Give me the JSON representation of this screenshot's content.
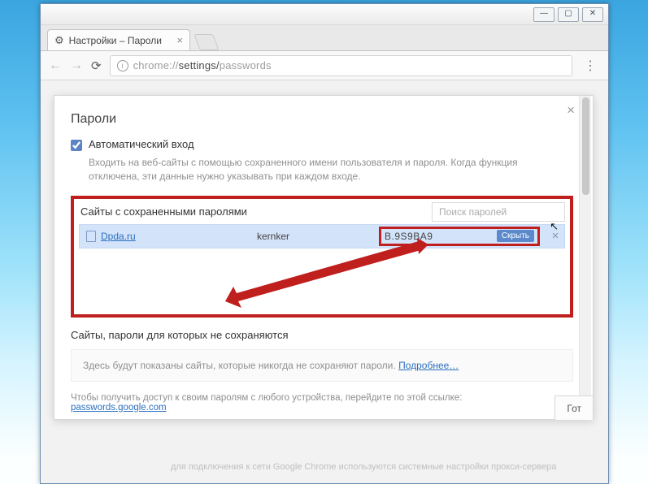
{
  "window": {
    "tab_title": "Настройки – Пароли",
    "url_prefix": "chrome://",
    "url_mid": "settings/",
    "url_end": "passwords"
  },
  "overlay": {
    "title": "Пароли",
    "auto_signin_label": "Автоматический вход",
    "auto_signin_help": "Входить на веб-сайты с помощью сохраненного имени пользователя и пароля. Когда функция отключена, эти данные нужно указывать при каждом входе.",
    "saved_title": "Сайты с сохраненными паролями",
    "search_placeholder": "Поиск паролей",
    "row": {
      "site": "Dpda.ru",
      "user": "kernker",
      "password": "B.9S9BA9",
      "hide_label": "Скрыть"
    },
    "never_save_title": "Сайты, пароли для которых не сохраняются",
    "never_save_empty": "Здесь будут показаны сайты, которые никогда не сохраняют пароли.",
    "never_save_more": "Подробнее…",
    "footer_text": "Чтобы получить доступ к своим паролям с любого устройства, перейдите по этой ссылке:",
    "footer_link": "passwords.google.com",
    "got_it": "Гот"
  },
  "ghost": "для подключения к сети Google Chrome используются системные настройки прокси-сервера"
}
